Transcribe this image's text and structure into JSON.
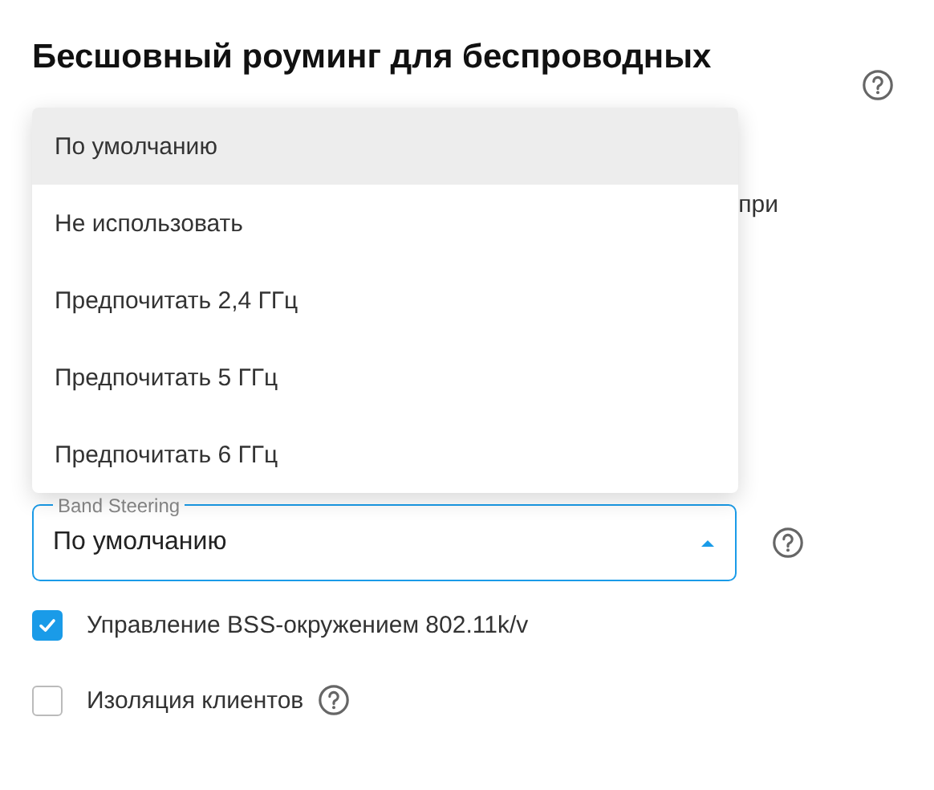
{
  "section": {
    "title": "Бесшовный роуминг для беспроводных",
    "description_fragment": "при"
  },
  "band_steering": {
    "label": "Band Steering",
    "value": "По умолчанию",
    "expanded": true,
    "options": [
      {
        "label": "По умолчанию",
        "selected": true
      },
      {
        "label": "Не использовать",
        "selected": false
      },
      {
        "label": "Предпочитать 2,4 ГГц",
        "selected": false
      },
      {
        "label": "Предпочитать 5 ГГц",
        "selected": false
      },
      {
        "label": "Предпочитать 6 ГГц",
        "selected": false
      }
    ]
  },
  "checkboxes": [
    {
      "label": "Управление BSS-окружением 802.11k/v",
      "checked": true,
      "help": false
    },
    {
      "label": "Изоляция клиентов",
      "checked": false,
      "help": true
    }
  ]
}
